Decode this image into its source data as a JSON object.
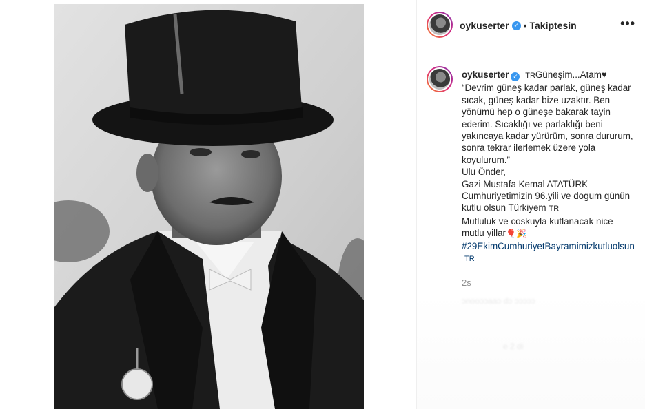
{
  "post": {
    "username": "oykuserter",
    "verified_badge": "✓",
    "separator": "•",
    "follow_status": "Takiptesin",
    "more_options": "•••",
    "caption": {
      "username": "oykuserter",
      "title_prefix": "TR",
      "title": "Güneşim...Atam",
      "title_heart": "♥",
      "body": "“Devrim güneş kadar parlak, güneş kadar sıcak, güneş kadar bize uzaktır. Ben yönümü hep o güneşe bakarak tayin ederim. Sıcaklığı ve parlaklığı beni yakıncaya kadar yürürüm, sonra dururum, sonra tekrar ilerlemek üzere yola koyulurum.”\nUlu Önder,\nGazi Mustafa Kemal ATATÜRK\nCumhuriyetimizin 96.yili ve dogum günün kutlu olsun Türkiyem",
      "flag_tr": "TR",
      "line_last": "\nMutluluk ve coskuyla kutlanacak nice mutlu yillar",
      "emojis": "🎈🎉",
      "hashtag": "#29EkimCumhuriyetBayramimizkutluolsun",
      "hashtag_flag": "TR"
    },
    "timestamp": "2s",
    "ghost_comment_1": "ɔnooɔɔaaɔ   dɔ   ɔɔɔɔɔ",
    "ghost_comment_2": "e 2      di"
  },
  "image": {
    "subject": "black-and-white portrait of man in top hat and tailcoat",
    "colors": {
      "background": "#d4d4d4",
      "hat": "#151515",
      "coat": "#1c1c1c",
      "shirt": "#efefef"
    }
  },
  "colors": {
    "verified": "#3897f0",
    "hashtag": "#00376b",
    "muted": "#8e8e8e",
    "text": "#262626"
  }
}
